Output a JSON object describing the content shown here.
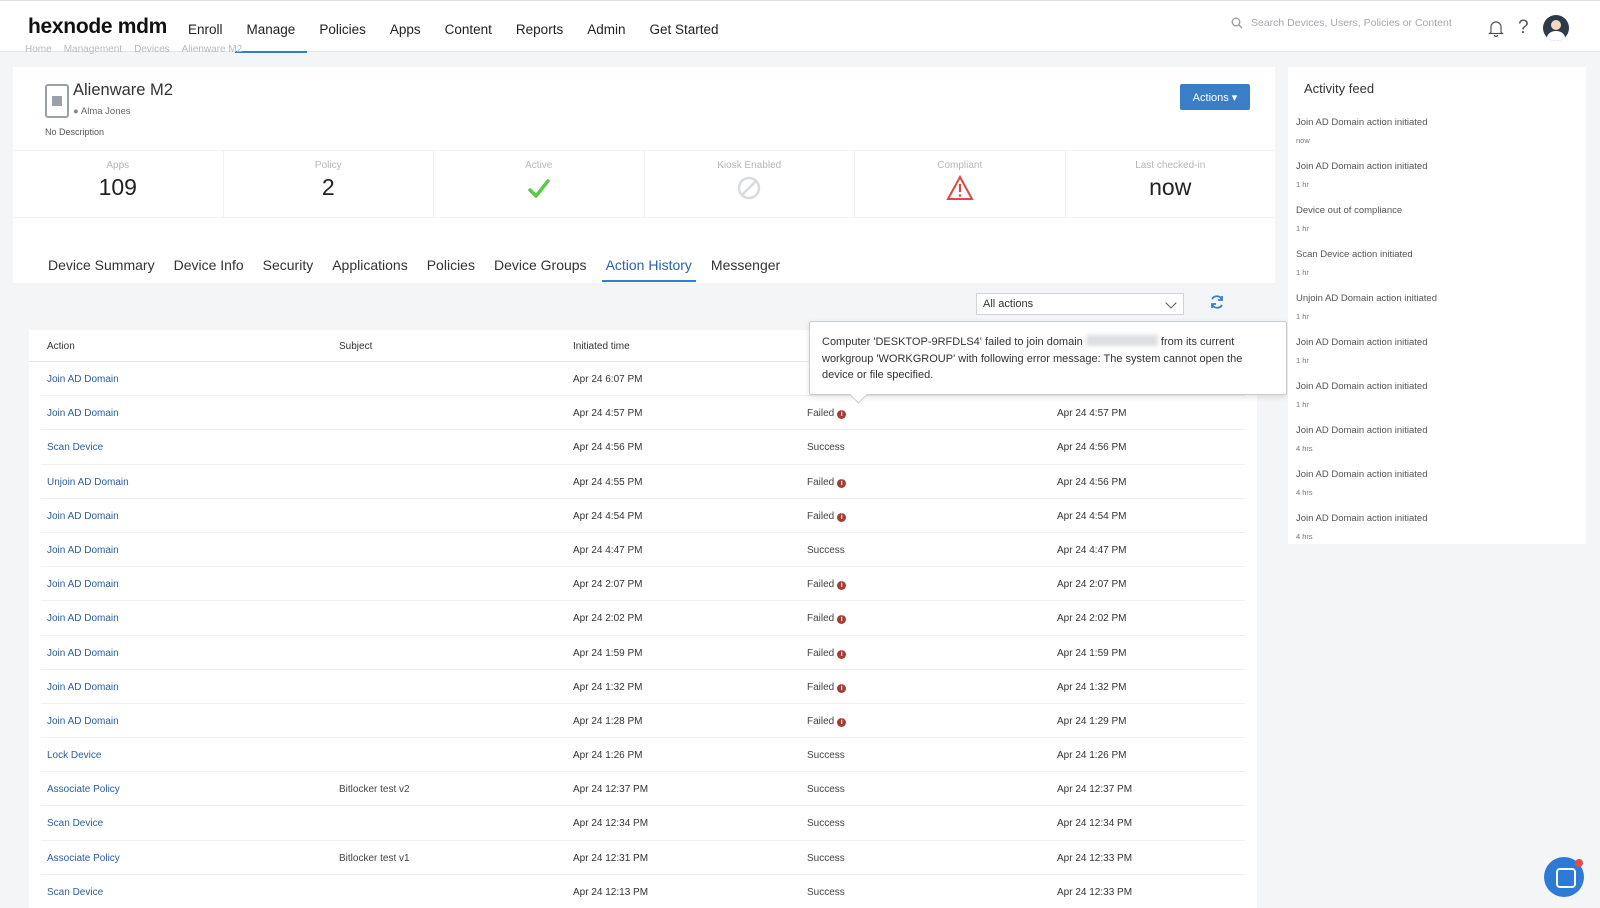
{
  "header": {
    "logo": "hexnode mdm",
    "nav": [
      "Enroll",
      "Manage",
      "Policies",
      "Apps",
      "Content",
      "Reports",
      "Admin",
      "Get Started"
    ],
    "active_nav": "Manage",
    "search_placeholder": "Search Devices, Users, Policies or Content"
  },
  "breadcrumb": [
    "Home",
    "Management",
    "Devices",
    "Alienware M2"
  ],
  "device": {
    "name": "Alienware M2",
    "user": "Alma Jones",
    "description": "No Description",
    "actions_label": "Actions ▾"
  },
  "stats": {
    "apps_label": "Apps",
    "apps_value": "109",
    "policy_label": "Policy",
    "policy_value": "2",
    "active_label": "Active",
    "kiosk_label": "Kiosk Enabled",
    "compliant_label": "Compliant",
    "checkin_label": "Last checked-in",
    "checkin_value": "now"
  },
  "tabs": [
    "Device Summary",
    "Device Info",
    "Security",
    "Applications",
    "Policies",
    "Device Groups",
    "Action History",
    "Messenger"
  ],
  "active_tab": "Action History",
  "filter": {
    "selected": "All actions"
  },
  "table": {
    "headers": {
      "action": "Action",
      "subject": "Subject",
      "initiated": "Initiated time"
    },
    "rows": [
      {
        "action": "Join AD Domain",
        "subject": "",
        "initiated": "Apr 24 6:07 PM",
        "status": "",
        "completed": ""
      },
      {
        "action": "Join AD Domain",
        "subject": "",
        "initiated": "Apr 24 4:57 PM",
        "status": "Failed",
        "completed": "Apr 24 4:57 PM"
      },
      {
        "action": "Scan Device",
        "subject": "",
        "initiated": "Apr 24 4:56 PM",
        "status": "Success",
        "completed": "Apr 24 4:56 PM"
      },
      {
        "action": "Unjoin AD Domain",
        "subject": "",
        "initiated": "Apr 24 4:55 PM",
        "status": "Failed",
        "completed": "Apr 24 4:56 PM"
      },
      {
        "action": "Join AD Domain",
        "subject": "",
        "initiated": "Apr 24 4:54 PM",
        "status": "Failed",
        "completed": "Apr 24 4:54 PM"
      },
      {
        "action": "Join AD Domain",
        "subject": "",
        "initiated": "Apr 24 4:47 PM",
        "status": "Success",
        "completed": "Apr 24 4:47 PM"
      },
      {
        "action": "Join AD Domain",
        "subject": "",
        "initiated": "Apr 24 2:07 PM",
        "status": "Failed",
        "completed": "Apr 24 2:07 PM"
      },
      {
        "action": "Join AD Domain",
        "subject": "",
        "initiated": "Apr 24 2:02 PM",
        "status": "Failed",
        "completed": "Apr 24 2:02 PM"
      },
      {
        "action": "Join AD Domain",
        "subject": "",
        "initiated": "Apr 24 1:59 PM",
        "status": "Failed",
        "completed": "Apr 24 1:59 PM"
      },
      {
        "action": "Join AD Domain",
        "subject": "",
        "initiated": "Apr 24 1:32 PM",
        "status": "Failed",
        "completed": "Apr 24 1:32 PM"
      },
      {
        "action": "Join AD Domain",
        "subject": "",
        "initiated": "Apr 24 1:28 PM",
        "status": "Failed",
        "completed": "Apr 24 1:29 PM"
      },
      {
        "action": "Lock Device",
        "subject": "",
        "initiated": "Apr 24 1:26 PM",
        "status": "Success",
        "completed": "Apr 24 1:26 PM"
      },
      {
        "action": "Associate Policy",
        "subject": "Bitlocker test v2",
        "initiated": "Apr 24 12:37 PM",
        "status": "Success",
        "completed": "Apr 24 12:37 PM"
      },
      {
        "action": "Scan Device",
        "subject": "",
        "initiated": "Apr 24 12:34 PM",
        "status": "Success",
        "completed": "Apr 24 12:34 PM"
      },
      {
        "action": "Associate Policy",
        "subject": "Bitlocker test v1",
        "initiated": "Apr 24 12:31 PM",
        "status": "Success",
        "completed": "Apr 24 12:33 PM"
      },
      {
        "action": "Scan Device",
        "subject": "",
        "initiated": "Apr 24 12:13 PM",
        "status": "Success",
        "completed": "Apr 24 12:33 PM"
      }
    ]
  },
  "tooltip": {
    "part1": "Computer 'DESKTOP-9RFDLS4' failed to join domain",
    "part2": "from its current workgroup 'WORKGROUP' with following error message: The system cannot open the device or file specified."
  },
  "feed": {
    "title": "Activity feed",
    "items": [
      {
        "text": "Join AD Domain action initiated",
        "time": "now"
      },
      {
        "text": "Join AD Domain action initiated",
        "time": "1 hr"
      },
      {
        "text": "Device out of compliance",
        "time": "1 hr"
      },
      {
        "text": "Scan Device action initiated",
        "time": "1 hr"
      },
      {
        "text": "Unjoin AD Domain action initiated",
        "time": "1 hr"
      },
      {
        "text": "Join AD Domain action initiated",
        "time": "1 hr"
      },
      {
        "text": "Join AD Domain action initiated",
        "time": "1 hr"
      },
      {
        "text": "Join AD Domain action initiated",
        "time": "4 hrs"
      },
      {
        "text": "Join AD Domain action initiated",
        "time": "4 hrs"
      },
      {
        "text": "Join AD Domain action initiated",
        "time": "4 hrs"
      }
    ]
  },
  "colors": {
    "accent": "#2f7fd1",
    "button": "#3b7ec8",
    "failed_icon": "#a83c35",
    "success_check": "#5cc94a",
    "warning": "#e0473e"
  },
  "icons": {
    "search": "search-icon",
    "bell": "bell-icon",
    "help": "help-icon",
    "refresh": "refresh-icon",
    "info": "info-icon"
  }
}
